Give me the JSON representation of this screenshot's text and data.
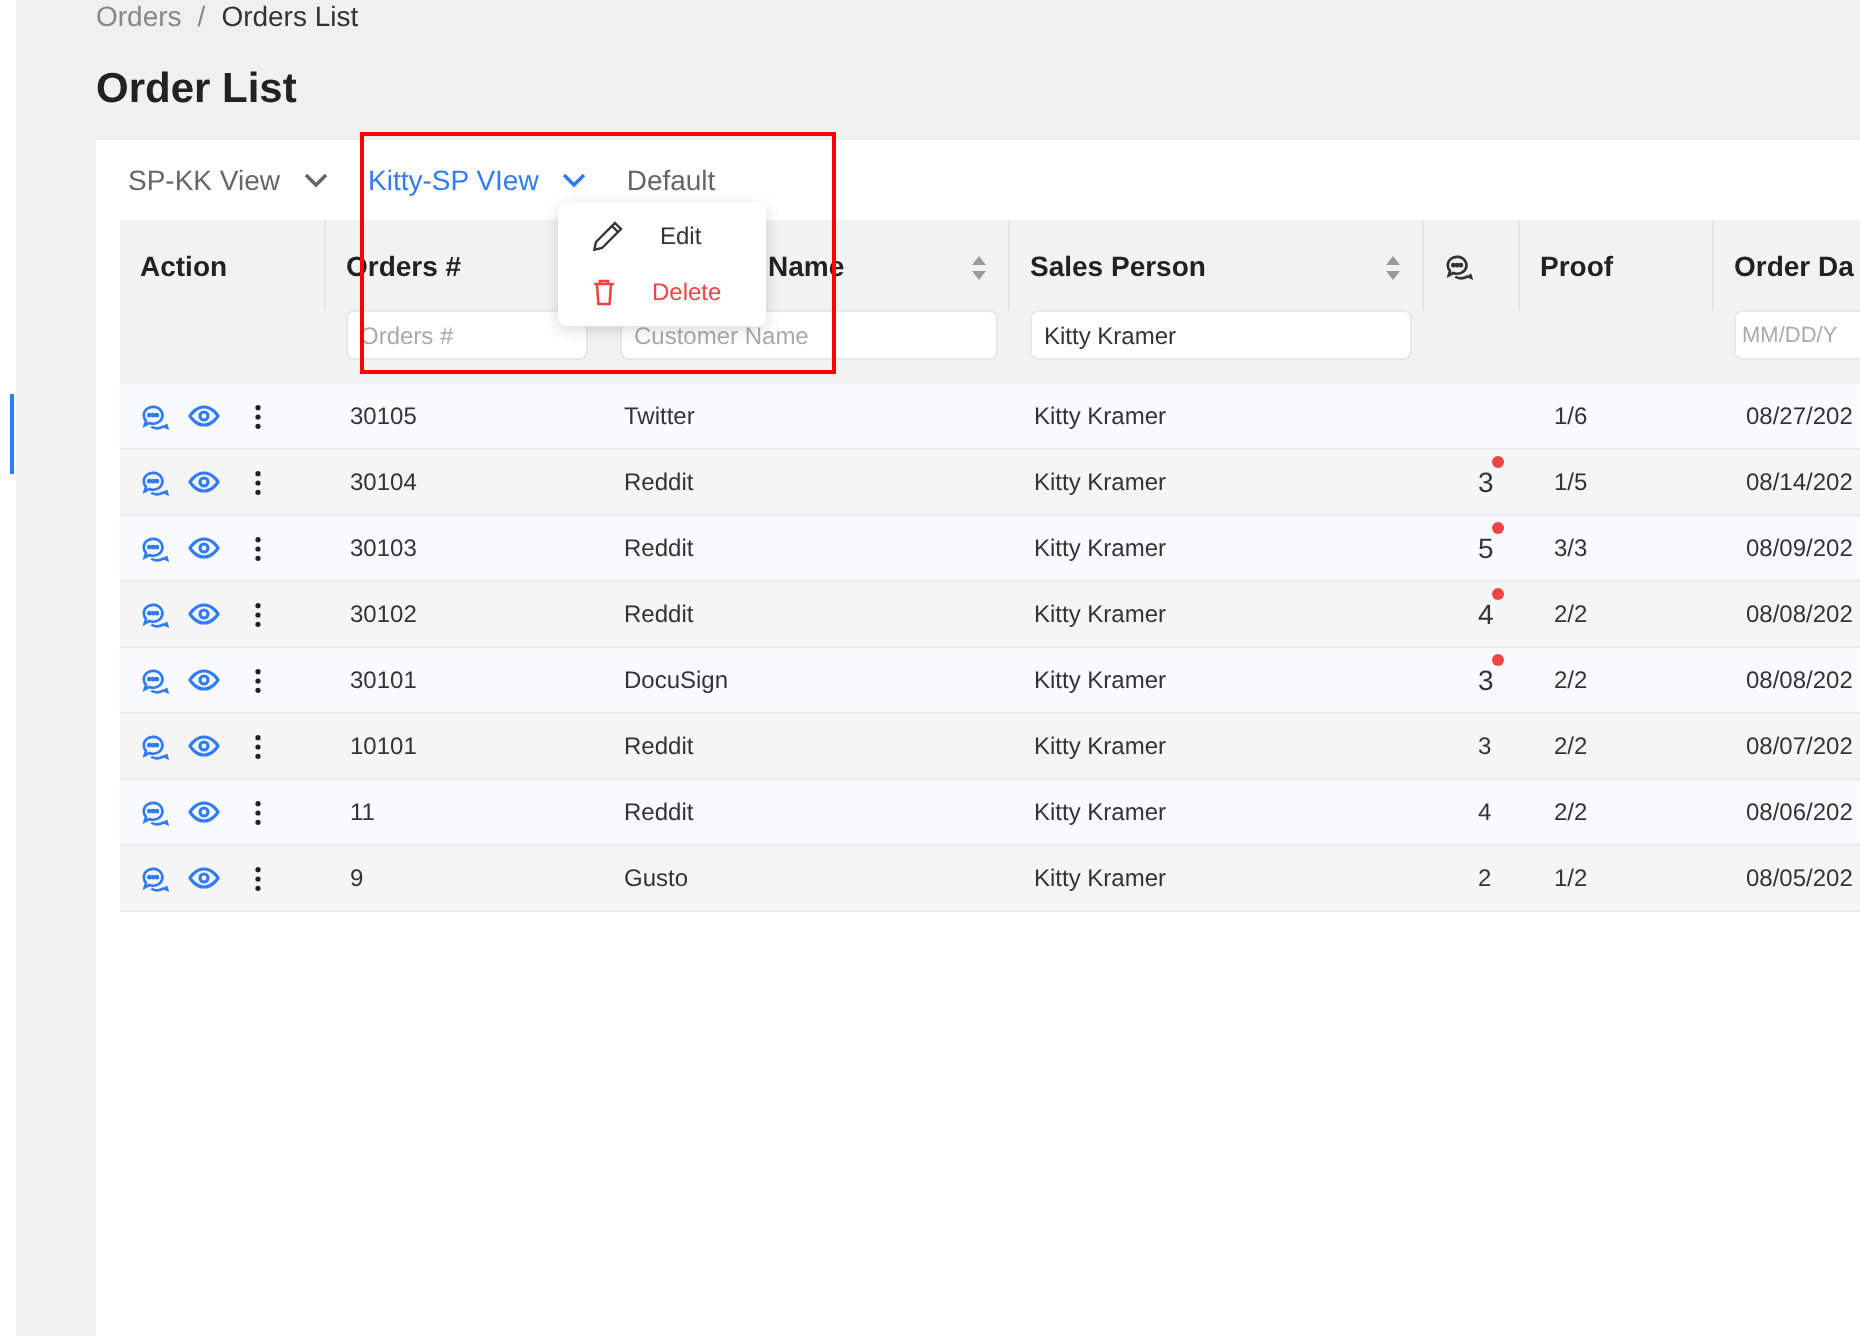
{
  "breadcrumb": {
    "items": [
      "Orders",
      "Orders List"
    ],
    "separator": "/"
  },
  "title": "Order List",
  "views": [
    {
      "label": "SP-KK View",
      "selected": false,
      "has_menu": true
    },
    {
      "label": "Kitty-SP VIew",
      "selected": true,
      "has_menu": true
    },
    {
      "label": "Default",
      "selected": false,
      "has_menu": false
    }
  ],
  "view_menu": [
    {
      "kind": "edit",
      "label": "Edit"
    },
    {
      "kind": "delete",
      "label": "Delete"
    }
  ],
  "table": {
    "columns": [
      {
        "label": "Action",
        "sortable": false,
        "kind": "text"
      },
      {
        "label": "Orders #",
        "kind": "text",
        "filter": {
          "placeholder": "Orders #"
        }
      },
      {
        "label": "Name",
        "sortable": true,
        "kind": "text",
        "filter": {
          "placeholder": "Customer Name"
        }
      },
      {
        "label": "Sales Person",
        "sortable": true,
        "kind": "text",
        "filter": {
          "value": "Kitty Kramer"
        }
      },
      {
        "kind": "comments"
      },
      {
        "label": "Proof",
        "sortable": false,
        "kind": "text"
      },
      {
        "label": "Order Da",
        "sortable": false,
        "kind": "text",
        "filter": {
          "placeholder": "MM/DD/Y"
        }
      }
    ],
    "rows": [
      {
        "order": "30105",
        "customer": "Twitter",
        "sales": "Kitty Kramer",
        "comments": null,
        "proof": "1/6",
        "date": "08/27/202"
      },
      {
        "order": "30104",
        "customer": "Reddit",
        "sales": "Kitty Kramer",
        "comments": "3",
        "unread": true,
        "proof": "1/5",
        "date": "08/14/202"
      },
      {
        "order": "30103",
        "customer": "Reddit",
        "sales": "Kitty Kramer",
        "comments": "5",
        "unread": true,
        "proof": "3/3",
        "date": "08/09/202"
      },
      {
        "order": "30102",
        "customer": "Reddit",
        "sales": "Kitty Kramer",
        "comments": "4",
        "unread": true,
        "proof": "2/2",
        "date": "08/08/202"
      },
      {
        "order": "30101",
        "customer": "DocuSign",
        "sales": "Kitty Kramer",
        "comments": "3",
        "unread": true,
        "proof": "2/2",
        "date": "08/08/202"
      },
      {
        "order": "10101",
        "customer": "Reddit",
        "sales": "Kitty Kramer",
        "comments": "3",
        "unread": false,
        "proof": "2/2",
        "date": "08/07/202"
      },
      {
        "order": "11",
        "customer": "Reddit",
        "sales": "Kitty Kramer",
        "comments": "4",
        "unread": false,
        "proof": "2/2",
        "date": "08/06/202"
      },
      {
        "order": "9",
        "customer": "Gusto",
        "sales": "Kitty Kramer",
        "comments": "2",
        "unread": false,
        "proof": "1/2",
        "date": "08/05/202"
      }
    ]
  }
}
